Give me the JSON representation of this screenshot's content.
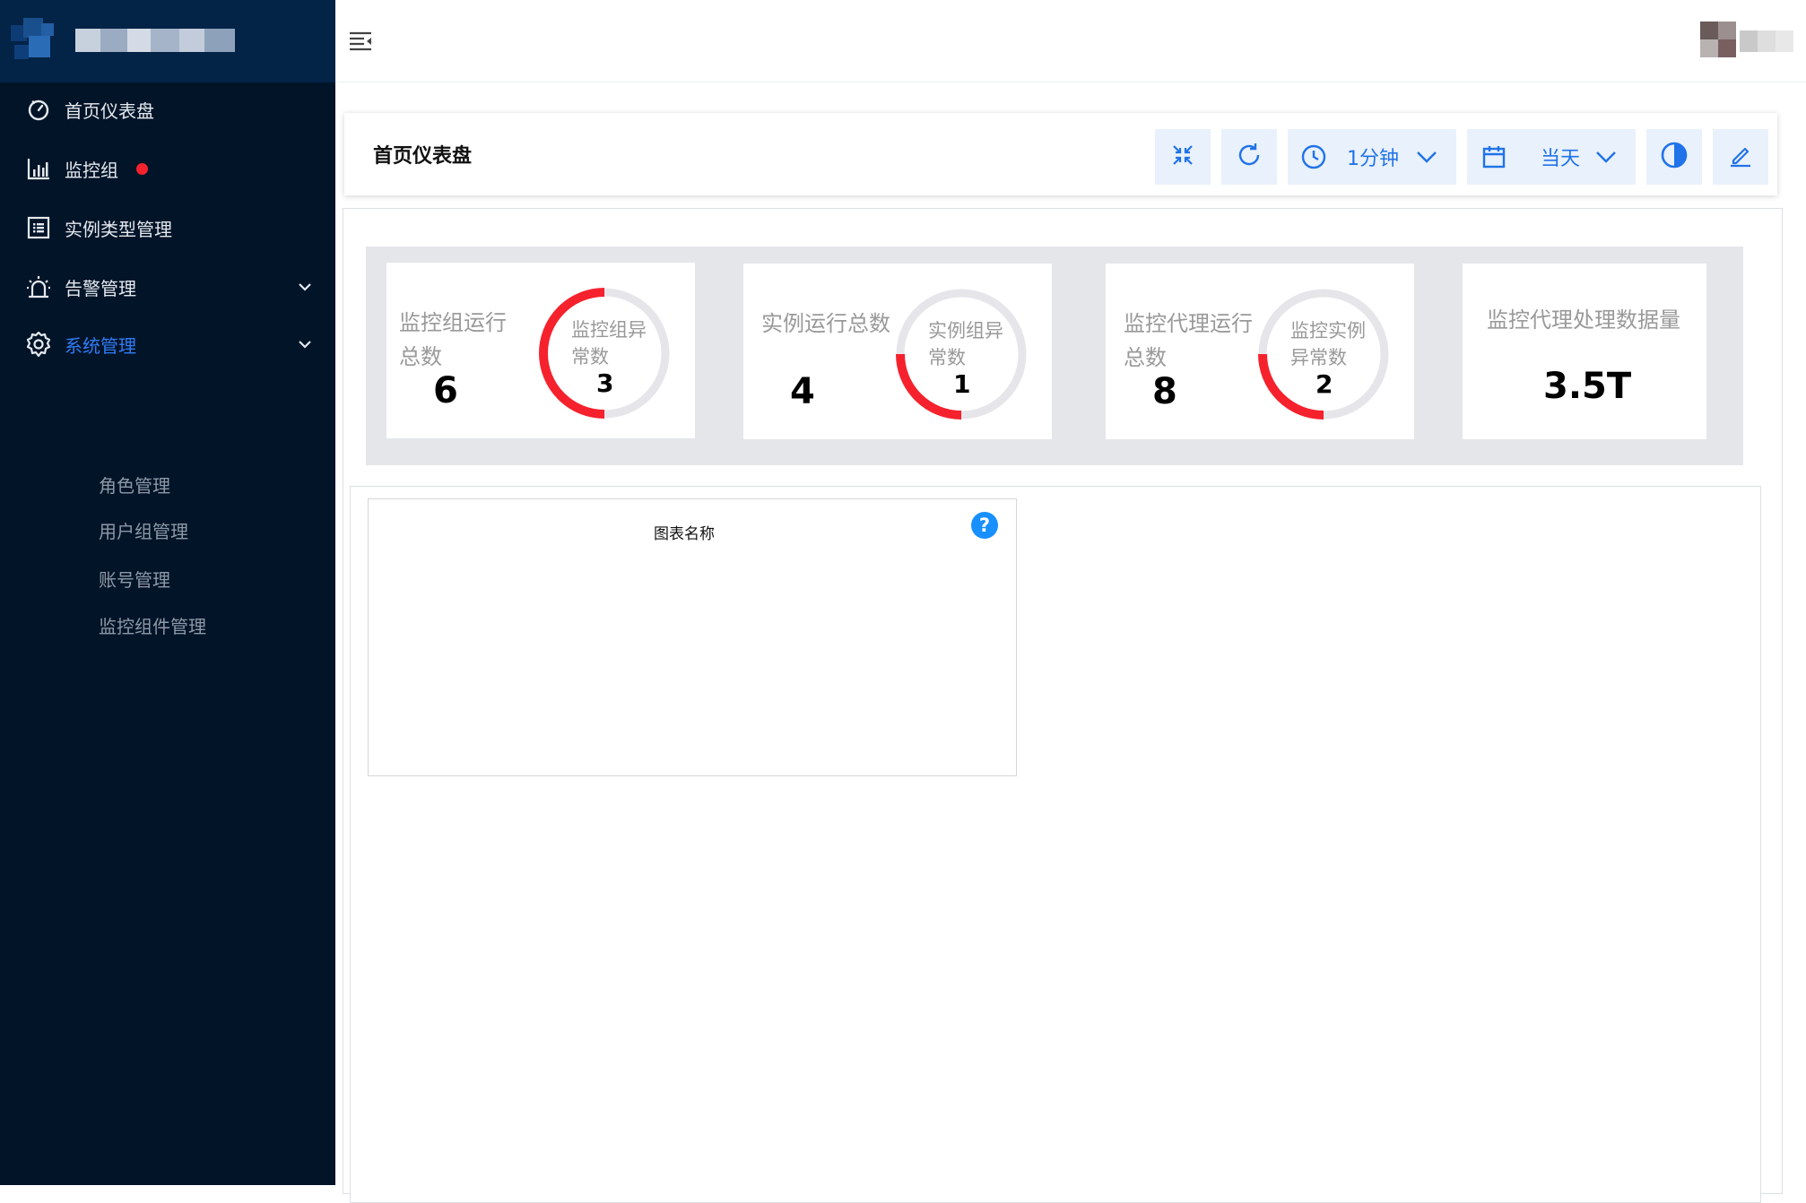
{
  "sidebar": {
    "items": [
      {
        "label": "首页仪表盘",
        "icon": "dashboard-icon"
      },
      {
        "label": "监控组",
        "icon": "bar-chart-icon",
        "badge_color": "#f5222d"
      },
      {
        "label": "实例类型管理",
        "icon": "list-icon"
      },
      {
        "label": "告警管理",
        "icon": "alarm-icon"
      },
      {
        "label": "系统管理",
        "icon": "gear-icon",
        "active": true
      }
    ],
    "sub_items": [
      "角色管理",
      "用户组管理",
      "账号管理",
      "监控组件管理"
    ]
  },
  "header": {
    "menu_icon": "menu-fold-icon"
  },
  "toolbar": {
    "title": "首页仪表盘",
    "interval_label": "1分钟",
    "range_label": "当天",
    "icons": [
      "collapse-icon",
      "refresh-icon",
      "clock-icon",
      "calendar-icon",
      "contrast-icon",
      "edit-icon"
    ]
  },
  "stats": [
    {
      "label_line1": "监控组运行",
      "label_line2": "总数",
      "value": "6",
      "ring_label_line1": "监控组异",
      "ring_label_line2": "常数",
      "ring_value": "3",
      "ring_fraction": 0.5
    },
    {
      "label_line1": "实例运行总数",
      "label_line2": "",
      "value": "4",
      "ring_label_line1": "实例组异",
      "ring_label_line2": "常数",
      "ring_value": "1",
      "ring_fraction": 0.25
    },
    {
      "label_line1": "监控代理运行",
      "label_line2": "总数",
      "value": "8",
      "ring_label_line1": "监控实例",
      "ring_label_line2": "异常数",
      "ring_value": "2",
      "ring_fraction": 0.25
    },
    {
      "label_line1": "监控代理处理数据量",
      "label_line2": "",
      "value": "3.5T"
    }
  ],
  "colors": {
    "accent": "#2073e8",
    "sidebar_bg": "#021428",
    "ring_alert": "#f5222d",
    "ring_track": "#e6e6ea"
  },
  "chart_card": {
    "title": "图表名称",
    "help": "?"
  }
}
